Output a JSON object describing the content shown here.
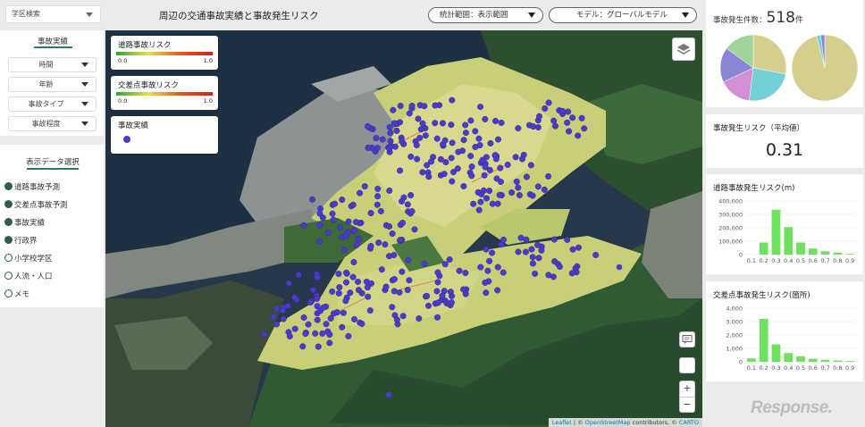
{
  "left_panel": {
    "school_district_select": "学区検索",
    "section_title": "事故実績",
    "filters": [
      "時間",
      "年齢",
      "事故タイプ",
      "事故程度"
    ],
    "display_title": "表示データ選択",
    "layers": [
      {
        "label": "道路事故予測",
        "checked": true
      },
      {
        "label": "交差点事故予測",
        "checked": true
      },
      {
        "label": "事故実績",
        "checked": true
      },
      {
        "label": "行政界",
        "checked": true
      },
      {
        "label": "小学校学区",
        "checked": false
      },
      {
        "label": "人流・人口",
        "checked": false
      },
      {
        "label": "メモ",
        "checked": false
      }
    ]
  },
  "header": {
    "title": "周辺の交通事故実績と事故発生リスク",
    "stat_range": "統計範囲：表示範囲",
    "model": "モデル：グローバルモデル"
  },
  "legend": {
    "road_risk": {
      "title": "道路事故リスク",
      "min": "0.0",
      "max": "1.0"
    },
    "intersection_risk": {
      "title": "交差点事故リスク",
      "min": "0.0",
      "max": "1.0"
    },
    "accidents": {
      "title": "事故実績"
    }
  },
  "map": {
    "zoom_in": "+",
    "zoom_out": "−",
    "attribution": {
      "leaflet": "Leaflet",
      "sep": " | © ",
      "osm": "OpenStreetMap",
      "contrib": " contributors, © ",
      "carto": "CARTO"
    }
  },
  "right_panel": {
    "count_label": "事故発生件数：",
    "count_value": "518",
    "count_unit": "件",
    "avg_risk_label": "事故発生リスク（平均値）",
    "avg_risk_value": "0.31",
    "road_hist_title": "道路事故発生リスク(m)",
    "intersection_hist_title": "交差点事故発生リスク(箇所)"
  },
  "brand": {
    "logo": "Response."
  },
  "colors": {
    "accent": "#2e7d54",
    "accident_dot": "#4b3cc8",
    "bar": "#6fe060"
  },
  "chart_data": [
    {
      "type": "pie",
      "title": "",
      "values": [
        28,
        24,
        16,
        17,
        15
      ],
      "colors": [
        "#d4cf8e",
        "#75cfd6",
        "#d18fd4",
        "#8a86d4",
        "#9fd49a"
      ]
    },
    {
      "type": "pie",
      "title": "",
      "values": [
        96,
        2,
        2
      ],
      "colors": [
        "#d4cf8e",
        "#75cfd6",
        "#8a86d4"
      ]
    },
    {
      "type": "bar",
      "title": "道路事故発生リスク(m)",
      "categories": [
        "0.1",
        "0.2",
        "0.3",
        "0.4",
        "0.5",
        "0.6",
        "0.7",
        "0.8",
        "0.9"
      ],
      "values": [
        0,
        90000,
        335000,
        205000,
        90000,
        45000,
        25000,
        15000,
        5000
      ],
      "yticks": [
        "0",
        "100,000",
        "200,000",
        "300,000",
        "400,000"
      ],
      "ylim": [
        0,
        400000
      ]
    },
    {
      "type": "bar",
      "title": "交差点事故発生リスク(箇所)",
      "categories": [
        "0.1",
        "0.2",
        "0.3",
        "0.4",
        "0.5",
        "0.6",
        "0.7",
        "0.8",
        "0.9"
      ],
      "values": [
        250,
        3200,
        1300,
        650,
        420,
        230,
        150,
        100,
        60
      ],
      "yticks": [
        "0",
        "1,000",
        "2,000",
        "3,000",
        "4,000"
      ],
      "ylim": [
        0,
        4000
      ]
    }
  ]
}
